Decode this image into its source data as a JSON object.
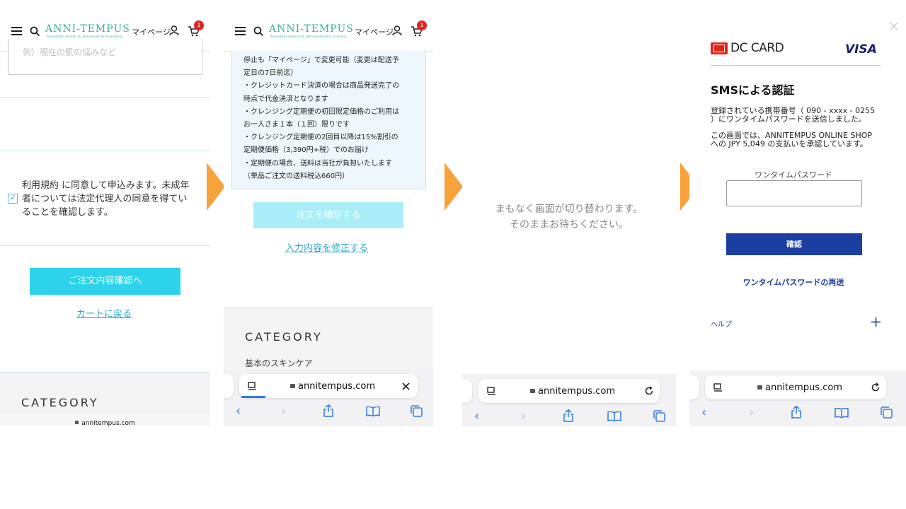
{
  "colors": {
    "accent_cyan": "#2dd3ea",
    "link_blue": "#2aa7c9",
    "arrow_orange": "#f7a23a",
    "dc_red": "#e2241b",
    "confirm_navy": "#1b3fa0",
    "visa_blue": "#1a1f71",
    "safari_blue": "#2f7ae5"
  },
  "header": {
    "logo": "ANNI-TEMPUS",
    "logo_tagline": "Excellent nature & Advanced skin science",
    "mypage": "マイページ",
    "cart_count": "1"
  },
  "panel1": {
    "textarea_placeholder": "例）現在の肌の悩みなど",
    "terms_line1": "利用規約 に同意して申込みます。未成年",
    "terms_line2": "者については法定代理人の同意を得てい",
    "terms_line3": "ることを確認します。",
    "confirm_button": "ご注文内容確認へ",
    "back_link": "カートに戻る",
    "category_title": "CATEGORY",
    "url": "annitempus.com"
  },
  "panel2": {
    "notice_lines": [
      "停止も「マイページ」で変更可能（変更は配送予",
      "定日の7日前迄）",
      "・クレジットカード決済の場合は商品発送完了の",
      "時点で代金決済となります",
      "・クレンジング定期便の初回限定価格のご利用は",
      "お一人さま１本（１回）限りです",
      "・クレンジング定期便の2回目以降は15%割引の",
      "定期便価格（3,390円+税）でのお届け",
      "・定期便の場合、送料は当社が負担いたします",
      "（単品ご注文の送料税込660円）"
    ],
    "confirm_order_button": "注文を確定する",
    "edit_link": "入力内容を修正する",
    "category_title": "CATEGORY",
    "category_item": "基本のスキンケア",
    "url": "annitempus.com"
  },
  "panel3": {
    "wait_line1": "まもなく画面が切り替わります。",
    "wait_line2": "そのままお待ちください。",
    "url": "annitempus.com"
  },
  "panel4": {
    "brand": "DC CARD",
    "card_network": "VISA",
    "title": "SMSによる認証",
    "sms_line1": "登録されている携帯番号（ 090 - xxxx - 0255",
    "sms_line2": "）にワンタイムパスワードを送信しました。",
    "approve_line1": "この画面では、ANNITEMPUS ONLINE SHOP",
    "approve_line2": "への JPY 5,049 の支払いを承認しています。",
    "otp_label": "ワンタイムパスワード",
    "otp_value": "",
    "confirm_button": "確認",
    "resend_link": "ワンタイムパスワードの再送",
    "help": "ヘルプ",
    "url": "annitempus.com"
  }
}
